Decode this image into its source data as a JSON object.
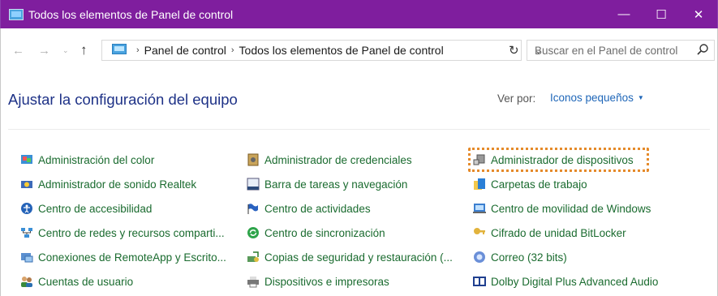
{
  "window": {
    "title": "Todos los elementos de Panel de control",
    "buttons": {
      "minimize": "—",
      "maximize": "☐",
      "close": "✕"
    }
  },
  "nav": {
    "back": "←",
    "forward": "→",
    "history": "⌄",
    "up": "↑"
  },
  "address": {
    "crumbs": [
      "Panel de control",
      "Todos los elementos de Panel de control"
    ],
    "separator": "›",
    "dropdown": "⌄",
    "refresh": "↻"
  },
  "search": {
    "placeholder": "Buscar en el Panel de control"
  },
  "content": {
    "heading": "Ajustar la configuración del equipo",
    "view_by_label": "Ver por:",
    "view_by_value": "Iconos pequeños"
  },
  "items": {
    "col1": [
      "Administración del color",
      "Administrador de sonido Realtek",
      "Centro de accesibilidad",
      "Centro de redes y recursos comparti...",
      "Conexiones de RemoteApp y Escrito...",
      "Cuentas de usuario"
    ],
    "col2": [
      "Administrador de credenciales",
      "Barra de tareas y navegación",
      "Centro de actividades",
      "Centro de sincronización",
      "Copias de seguridad y restauración (...",
      "Dispositivos e impresoras"
    ],
    "col3": [
      "Administrador de dispositivos",
      "Carpetas de trabajo",
      "Centro de movilidad de Windows",
      "Cifrado de unidad BitLocker",
      "Correo (32 bits)",
      "Dolby Digital Plus Advanced Audio"
    ]
  },
  "colors": {
    "titlebar": "#7f1e9e",
    "link_green": "#1a6b2f",
    "heading_blue": "#1e3287",
    "highlight": "#e58a2a"
  }
}
